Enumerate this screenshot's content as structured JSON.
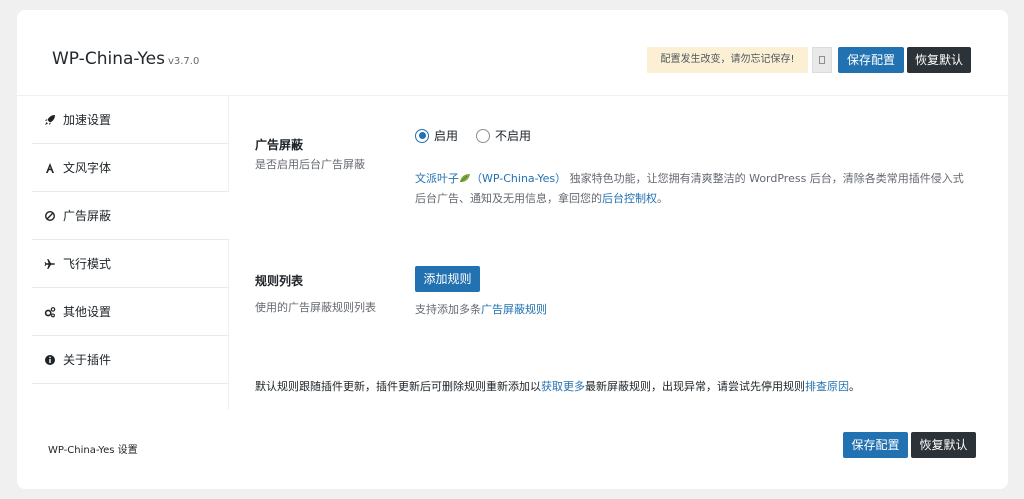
{
  "header": {
    "title": "WP-China-Yes",
    "version": "v3.7.0",
    "notice": "配置发生改变，请勿忘记保存!",
    "save_label": "保存配置",
    "reset_label": "恢复默认"
  },
  "sidebar": {
    "items": [
      {
        "label": "加速设置",
        "icon": "rocket-icon"
      },
      {
        "label": "文风字体",
        "icon": "font-icon"
      },
      {
        "label": "广告屏蔽",
        "icon": "ban-icon",
        "active": true
      },
      {
        "label": "飞行模式",
        "icon": "plane-icon"
      },
      {
        "label": "其他设置",
        "icon": "gears-icon"
      },
      {
        "label": "关于插件",
        "icon": "info-icon"
      }
    ]
  },
  "main": {
    "ad_block": {
      "title": "广告屏蔽",
      "desc": "是否启用后台广告屏蔽",
      "options": [
        "启用",
        "不启用"
      ],
      "selected": "启用",
      "intro_link1": "文派叶子",
      "intro_link2": "（WP-China-Yes）",
      "intro_text1": "独家特色功能，让您拥有清爽整洁的 WordPress 后台，清除各类常用插件侵入式后台广告、通知及无用信息，拿回您的",
      "intro_link3": "后台控制权",
      "intro_text2": "。"
    },
    "rules": {
      "title": "规则列表",
      "desc": "使用的广告屏蔽规则列表",
      "add_button": "添加规则",
      "hint_text": "支持添加多条",
      "hint_link": "广告屏蔽规则"
    },
    "footnote": {
      "text1": "默认规则跟随插件更新，插件更新后可删除规则重新添加以",
      "link1": "获取更多",
      "text2": "最新屏蔽规则，出现异常，请尝试先停用规则",
      "link2": "排查原因",
      "text3": "。"
    }
  },
  "footer": {
    "text": "WP-China-Yes 设置",
    "save_label": "保存配置",
    "reset_label": "恢复默认"
  },
  "colors": {
    "accent": "#2271b1",
    "dark_button": "#2c3338",
    "notice_bg": "#fcf0d4",
    "page_bg": "#f0f0f1"
  }
}
